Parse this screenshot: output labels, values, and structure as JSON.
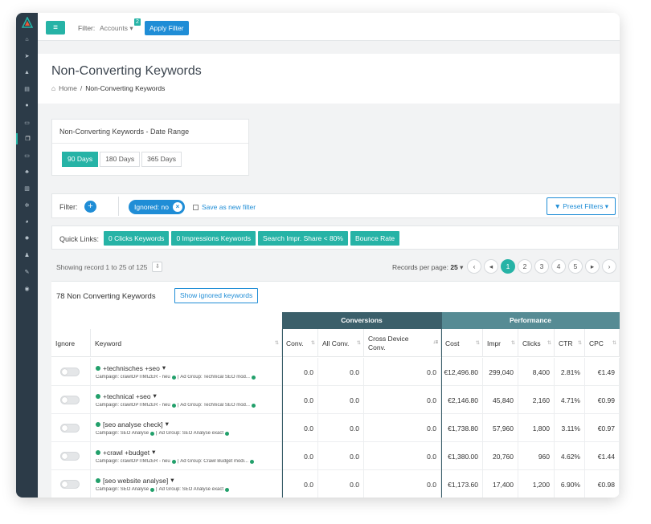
{
  "topbar": {
    "filter_label": "Filter:",
    "accounts_label": "Accounts",
    "accounts_badge": "2",
    "apply_label": "Apply Filter"
  },
  "sidebar": {
    "icons": [
      "home-icon",
      "paper-plane-icon",
      "chart-area-icon",
      "table-icon",
      "globe-icon",
      "window-icon",
      "copy-icon",
      "monitor-icon",
      "sitemap-icon",
      "bar-chart-icon",
      "cogs-icon",
      "pie-icon",
      "gear-icon",
      "user-icon",
      "wrench-icon",
      "eye-icon"
    ],
    "active_index": 6
  },
  "page": {
    "title": "Non-Converting Keywords",
    "breadcrumb_home": "Home",
    "breadcrumb_sep": "/",
    "breadcrumb_current": "Non-Converting Keywords"
  },
  "date_range": {
    "title": "Non-Converting Keywords - Date Range",
    "options": [
      "90 Days",
      "180 Days",
      "365 Days"
    ],
    "selected": "90 Days"
  },
  "filter": {
    "label": "Filter:",
    "chip": "Ignored: no",
    "save_label": "Save as new filter",
    "preset_label": "Preset Filters"
  },
  "quick_links": {
    "label": "Quick Links:",
    "items": [
      "0 Clicks Keywords",
      "0 Impressions Keywords",
      "Search Impr. Share < 80%",
      "Bounce Rate"
    ]
  },
  "records": {
    "info": "Showing record 1 to 25 of 125",
    "per_page_label": "Records per page:",
    "per_page_value": "25",
    "pages": [
      "1",
      "2",
      "3",
      "4",
      "5"
    ],
    "current_page": "1"
  },
  "table": {
    "count_label": "78 Non Converting Keywords",
    "show_ignored_label": "Show ignored keywords",
    "group_conversions": "Conversions",
    "group_performance": "Performance",
    "columns": {
      "ignore": "Ignore",
      "keyword": "Keyword",
      "conv": "Conv.",
      "all_conv": "All Conv.",
      "cross_device": "Cross Device Conv.",
      "cost": "Cost",
      "impr": "Impr",
      "clicks": "Clicks",
      "ctr": "CTR",
      "cpc": "CPC"
    },
    "rows": [
      {
        "keyword": "+technisches +seo",
        "campaign": "Campaign: crawlOPTIMIZER - neu",
        "adgroup": "Ad Group: Technical SEO mod...",
        "conv": "0.0",
        "all_conv": "0.0",
        "cross": "0.0",
        "cost": "€12,496.80",
        "impr": "299,040",
        "clicks": "8,400",
        "ctr": "2.81%",
        "cpc": "€1.49"
      },
      {
        "keyword": "+technical +seo",
        "campaign": "Campaign: crawlOPTIMIZER - neu",
        "adgroup": "Ad Group: Technical SEO mod...",
        "conv": "0.0",
        "all_conv": "0.0",
        "cross": "0.0",
        "cost": "€2,146.80",
        "impr": "45,840",
        "clicks": "2,160",
        "ctr": "4.71%",
        "cpc": "€0.99"
      },
      {
        "keyword": "[seo analyse check]",
        "campaign": "Campaign: SEO Analyse",
        "adgroup": "Ad Group: SEO Analyse exact",
        "conv": "0.0",
        "all_conv": "0.0",
        "cross": "0.0",
        "cost": "€1,738.80",
        "impr": "57,960",
        "clicks": "1,800",
        "ctr": "3.11%",
        "cpc": "€0.97"
      },
      {
        "keyword": "+crawl +budget",
        "campaign": "Campaign: crawlOPTIMIZER - neu",
        "adgroup": "Ad Group: Crawl Budget modi...",
        "conv": "0.0",
        "all_conv": "0.0",
        "cross": "0.0",
        "cost": "€1,380.00",
        "impr": "20,760",
        "clicks": "960",
        "ctr": "4.62%",
        "cpc": "€1.44"
      },
      {
        "keyword": "[seo website analyse]",
        "campaign": "Campaign: SEO Analyse",
        "adgroup": "Ad Group: SEO Analyse exact",
        "conv": "0.0",
        "all_conv": "0.0",
        "cross": "0.0",
        "cost": "€1,173.60",
        "impr": "17,400",
        "clicks": "1,200",
        "ctr": "6.90%",
        "cpc": "€0.98"
      }
    ]
  }
}
